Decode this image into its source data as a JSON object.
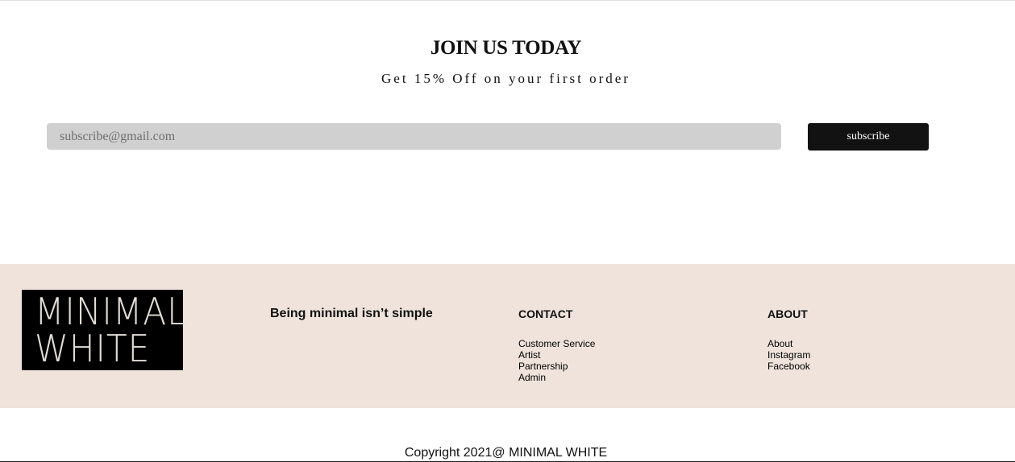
{
  "join": {
    "title": "JOIN US TODAY",
    "subtitle": "Get 15% Off on your first order",
    "email_placeholder": "subscribe@gmail.com",
    "email_value": "",
    "subscribe_label": "subscribe"
  },
  "footer": {
    "logo_lines": [
      "MINIMAL",
      "WHITE"
    ],
    "tagline": "Being minimal isn’t simple",
    "contact": {
      "heading": "CONTACT",
      "links": [
        "Customer Service",
        "Artist",
        "Partnership",
        "Admin"
      ]
    },
    "about": {
      "heading": "ABOUT",
      "links": [
        "About",
        "Instagram",
        "Facebook"
      ]
    },
    "background_color": "#efe3dc"
  },
  "copyright": "Copyright 2021@ MINIMAL WHITE"
}
